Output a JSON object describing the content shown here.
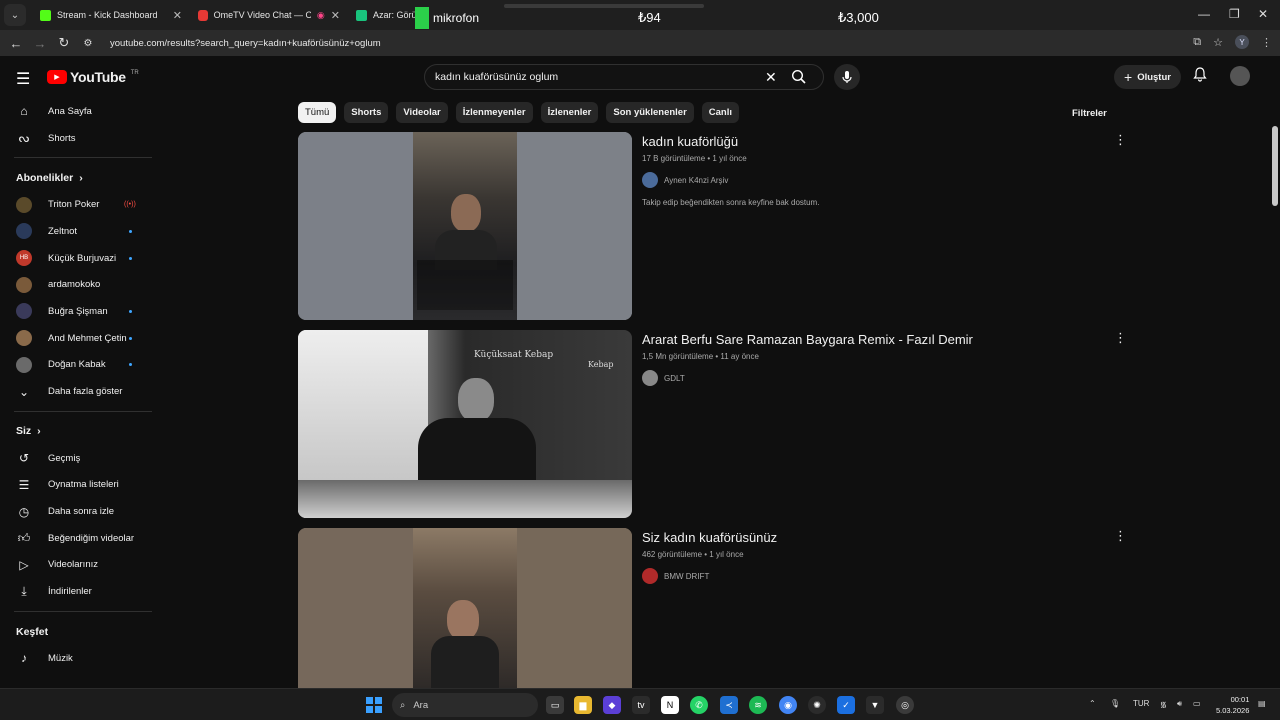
{
  "browser": {
    "tabs": [
      {
        "title": "Stream - Kick Dashboard",
        "color": "#53fc18"
      },
      {
        "title": "OmeTV Video Chat — Ome",
        "color": "#e53935"
      },
      {
        "title": "Azar: Görüntü",
        "color": "#19c37d"
      }
    ],
    "url": "youtube.com/results?search_query=kadın+kuaförüsünüz+oglum"
  },
  "overlay": {
    "mic_label": "mikrofon",
    "value_1": "₺94",
    "value_2": "₺3,000"
  },
  "header": {
    "logo_text": "YouTube",
    "country": "TR",
    "search_value": "kadın kuaförüsünüz oglum",
    "create_label": "Oluştur"
  },
  "sidebar": {
    "main": [
      {
        "label": "Ana Sayfa",
        "icon": "home-icon"
      },
      {
        "label": "Shorts",
        "icon": "shorts-icon"
      }
    ],
    "subs_title": "Abonelikler",
    "subs": [
      {
        "label": "Triton Poker",
        "color": "#5a4a2a",
        "indicator": "live"
      },
      {
        "label": "Zeltnot",
        "color": "#2a3a5a",
        "indicator": "dot"
      },
      {
        "label": "Küçük Burjuvazi",
        "color": "#c0392b",
        "initials": "HB",
        "indicator": "dot"
      },
      {
        "label": "ardamokoko",
        "color": "#7a5a3a",
        "indicator": "none"
      },
      {
        "label": "Buğra Şişman",
        "color": "#3a3a5a",
        "indicator": "dot"
      },
      {
        "label": "And Mehmet Çetin",
        "color": "#8a6a4a",
        "indicator": "dot"
      },
      {
        "label": "Doğan Kabak",
        "color": "#6a6a6a",
        "indicator": "dot"
      }
    ],
    "show_more": "Daha fazla göster",
    "you_title": "Siz",
    "you": [
      {
        "label": "Geçmiş",
        "icon": "history-icon"
      },
      {
        "label": "Oynatma listeleri",
        "icon": "playlist-icon"
      },
      {
        "label": "Daha sonra izle",
        "icon": "clock-icon"
      },
      {
        "label": "Beğendiğim videolar",
        "icon": "thumbs-up-icon"
      },
      {
        "label": "Videolarınız",
        "icon": "video-icon"
      },
      {
        "label": "İndirilenler",
        "icon": "download-icon"
      }
    ],
    "explore_title": "Keşfet",
    "explore": [
      {
        "label": "Müzik",
        "icon": "music-icon"
      }
    ]
  },
  "chips": [
    "Tümü",
    "Shorts",
    "Videolar",
    "İzlenmeyenler",
    "İzlenenler",
    "Son yüklenenler",
    "Canlı"
  ],
  "filters_label": "Filtreler",
  "results": [
    {
      "title": "kadın kuaförlüğü",
      "meta": "17 B görüntüleme • 1 yıl önce",
      "channel": "Aynen K4nzi Arşiv",
      "description": "Takip edip beğendikten sonra keyfine bak dostum."
    },
    {
      "title": "Ararat Berfu Sare Ramazan Baygara Remix - Fazıl Demir",
      "meta": "1,5 Mn görüntüleme • 11 ay önce",
      "channel": "GDLT",
      "description": "",
      "thumb_signs": [
        "Küçüksaat Kebap",
        "Kebap"
      ]
    },
    {
      "title": "Siz kadın kuaförüsünüz",
      "meta": "462 görüntüleme • 1 yıl önce",
      "channel": "BMW DRIFT",
      "description": ""
    }
  ],
  "taskbar": {
    "search_label": "Ara",
    "language": "TUR",
    "time": "00:01",
    "date": "5.03.2026"
  }
}
